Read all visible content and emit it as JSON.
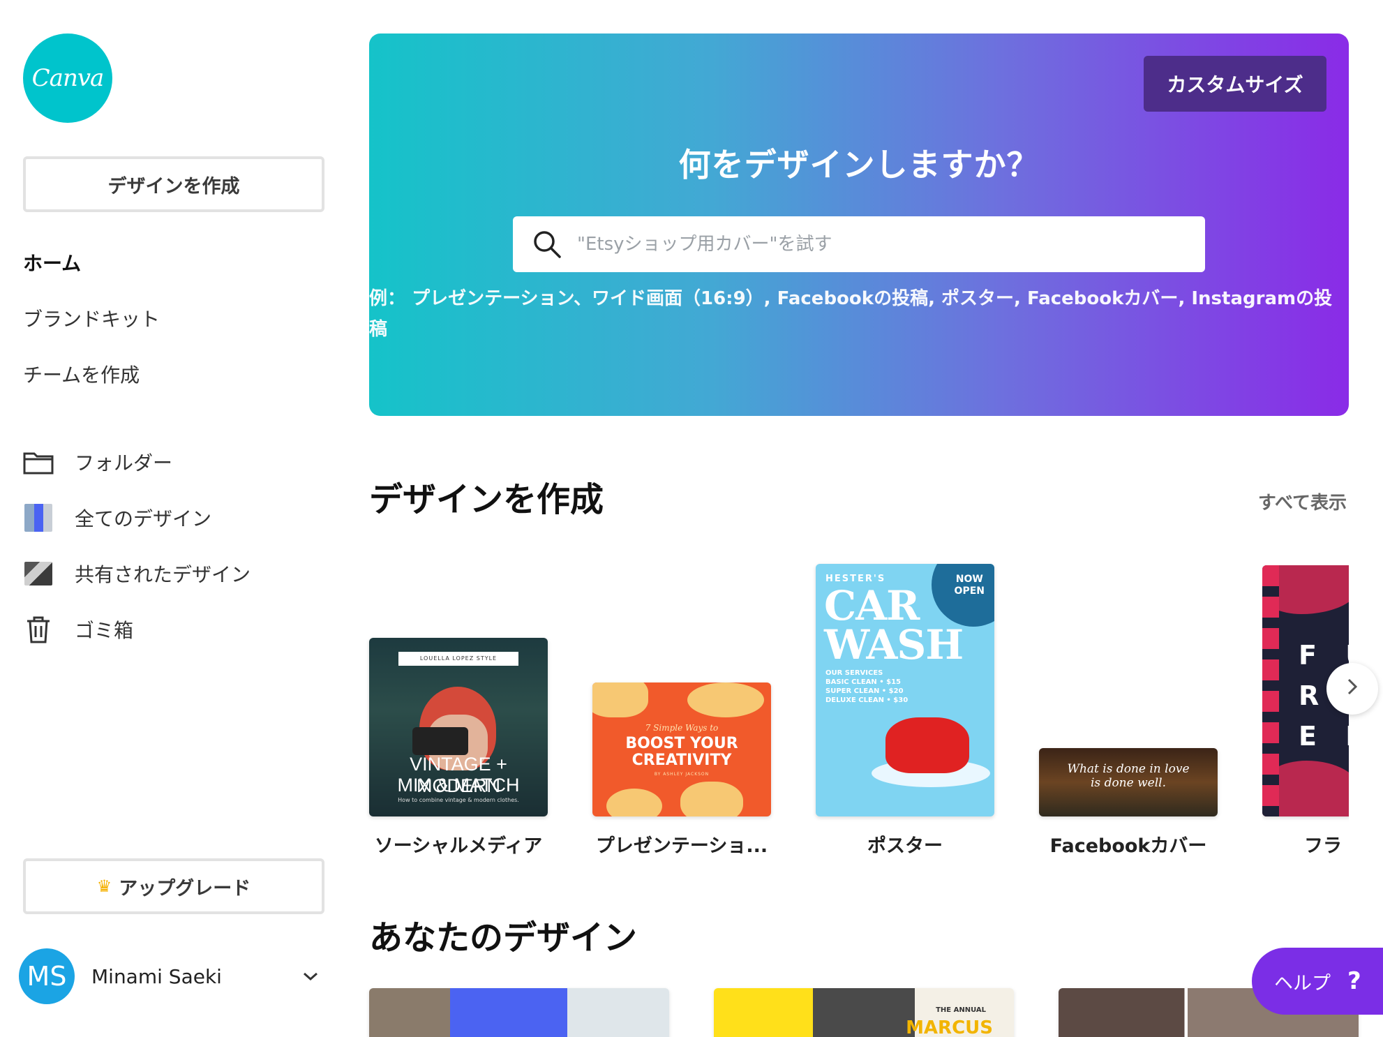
{
  "app": {
    "logo_text": "Canva",
    "brand_color": "#00c4cc",
    "accent_color": "#7b2ee6"
  },
  "sidebar": {
    "create_button": "デザインを作成",
    "nav": [
      {
        "label": "ホーム",
        "active": true
      },
      {
        "label": "ブランドキット",
        "active": false
      },
      {
        "label": "チームを作成",
        "active": false
      }
    ],
    "library": [
      {
        "label": "フォルダー",
        "icon": "folder-icon"
      },
      {
        "label": "全てのデザイン",
        "icon": "all-designs-thumbnail"
      },
      {
        "label": "共有されたデザイン",
        "icon": "shared-designs-thumbnail"
      },
      {
        "label": "ゴミ箱",
        "icon": "trash-icon"
      }
    ],
    "upgrade_button": "アップグレード",
    "upgrade_icon": "crown-icon",
    "user": {
      "initials": "MS",
      "name": "Minami Saeki",
      "avatar_color": "#1ba4e4"
    }
  },
  "hero": {
    "custom_size_button": "カスタムサイズ",
    "title": "何をデザインしますか？",
    "search_placeholder": "\"Etsyショップ用カバー\"を試す",
    "examples_prefix": "例：",
    "examples": [
      "プレゼンテーション、ワイド画面（16:9）",
      "Facebookの投稿",
      "ポスター",
      "Facebookカバー",
      "Instagramの投稿"
    ],
    "gradient": [
      "#15c3c9",
      "#8a2be7"
    ]
  },
  "create_section": {
    "title": "デザインを作成",
    "see_all": "すべて表示",
    "templates": [
      {
        "label": "ソーシャルメディア",
        "thumb_text": [
          "LOUELLA LOPEZ STYLE",
          "VINTAGE + MODERN",
          "MIX & MATCH",
          "How to combine vintage & modern clothes."
        ]
      },
      {
        "label": "プレゼンテーショ...",
        "thumb_text": [
          "7 Simple Ways to",
          "BOOST YOUR",
          "CREATIVITY",
          "BY ASHLEY JACKSON"
        ]
      },
      {
        "label": "ポスター",
        "thumb_text": [
          "HESTER'S",
          "CAR",
          "WASH",
          "NOW",
          "OPEN",
          "OUR SERVICES",
          "BASIC CLEAN • $15",
          "SUPER CLEAN • $20",
          "DELUXE CLEAN • $30"
        ]
      },
      {
        "label": "Facebookカバー",
        "thumb_text": [
          "What is done in love",
          "is done well."
        ]
      },
      {
        "label": "フラ",
        "thumb_text": [
          "F U",
          "R",
          "E R"
        ]
      }
    ]
  },
  "your_designs": {
    "title": "あなたのデザイン",
    "thumb_text": [
      "THE ANNUAL",
      "MARCUS"
    ]
  },
  "help_button": {
    "label": "ヘルプ",
    "icon_text": "?"
  }
}
